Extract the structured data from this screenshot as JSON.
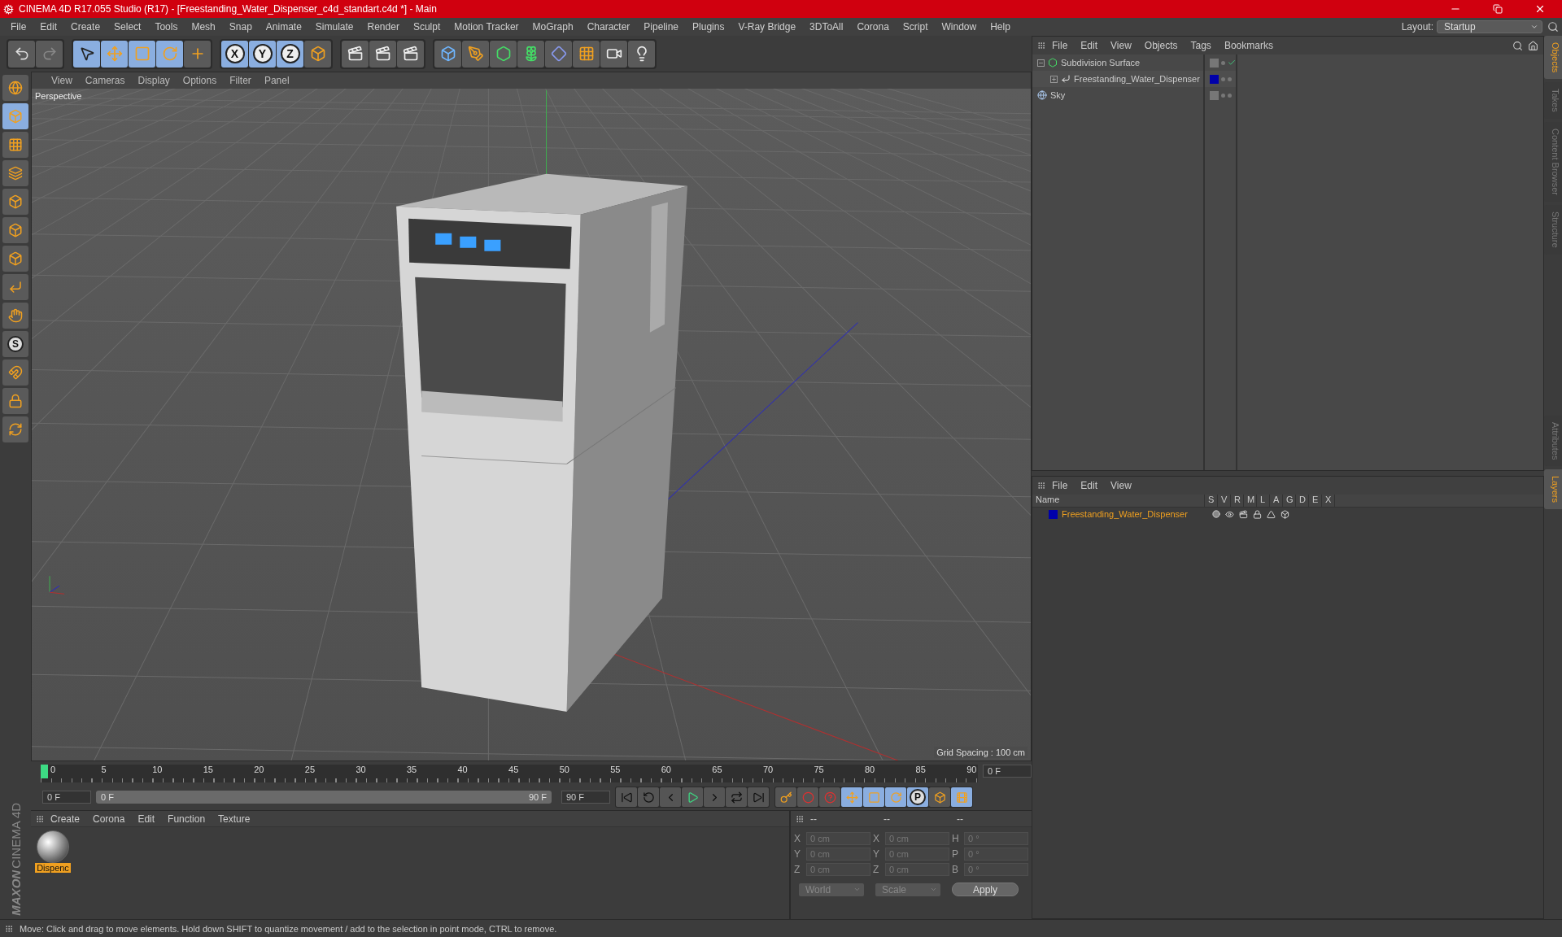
{
  "window": {
    "title": "CINEMA 4D R17.055 Studio (R17) - [Freestanding_Water_Dispenser_c4d_standart.c4d *] - Main"
  },
  "menu": [
    "File",
    "Edit",
    "Create",
    "Select",
    "Tools",
    "Mesh",
    "Snap",
    "Animate",
    "Simulate",
    "Render",
    "Sculpt",
    "Motion Tracker",
    "MoGraph",
    "Character",
    "Pipeline",
    "Plugins",
    "V-Ray Bridge",
    "3DToAll",
    "Corona",
    "Script",
    "Window",
    "Help"
  ],
  "layout": {
    "label": "Layout:",
    "value": "Startup"
  },
  "toolbar": [
    {
      "kind": "undo",
      "selected": false
    },
    {
      "kind": "redo",
      "selected": false
    },
    {
      "kind": "select",
      "selected": true
    },
    {
      "kind": "move",
      "selected": true
    },
    {
      "kind": "scale",
      "selected": true
    },
    {
      "kind": "rotate",
      "selected": true
    },
    {
      "kind": "transform",
      "selected": false
    },
    {
      "kind": "axis",
      "label": "X",
      "selected": true
    },
    {
      "kind": "axis",
      "label": "Y",
      "selected": true
    },
    {
      "kind": "axis",
      "label": "Z",
      "selected": true
    },
    {
      "kind": "coords",
      "selected": false
    },
    {
      "kind": "render-view",
      "selected": false
    },
    {
      "kind": "render-picture",
      "selected": false
    },
    {
      "kind": "render-settings",
      "selected": false
    },
    {
      "kind": "cube",
      "selected": false
    },
    {
      "kind": "pen",
      "selected": false
    },
    {
      "kind": "subdivide",
      "selected": false
    },
    {
      "kind": "cloner",
      "selected": false
    },
    {
      "kind": "deformer",
      "selected": false
    },
    {
      "kind": "floor",
      "selected": false
    },
    {
      "kind": "camera",
      "selected": false
    },
    {
      "kind": "light",
      "selected": false
    }
  ],
  "left_tools": [
    {
      "kind": "make-editable",
      "selected": false
    },
    {
      "kind": "model",
      "selected": true
    },
    {
      "kind": "texture",
      "selected": false
    },
    {
      "kind": "workplane",
      "selected": false
    },
    {
      "kind": "points",
      "selected": false
    },
    {
      "kind": "edges",
      "selected": false
    },
    {
      "kind": "polygons",
      "selected": false
    },
    {
      "kind": "axis",
      "selected": false
    },
    {
      "kind": "tweak",
      "selected": false
    },
    {
      "kind": "snap",
      "label": "S",
      "selected": false
    },
    {
      "kind": "magnet",
      "selected": false
    },
    {
      "kind": "grid-lock",
      "selected": false
    },
    {
      "kind": "grid-rotate",
      "selected": false
    }
  ],
  "viewport": {
    "menu": [
      "View",
      "Cameras",
      "Display",
      "Options",
      "Filter",
      "Panel"
    ],
    "label": "Perspective",
    "grid_spacing": "Grid Spacing : 100 cm"
  },
  "timeline": {
    "ticks": [
      "0",
      "5",
      "10",
      "15",
      "20",
      "25",
      "30",
      "35",
      "40",
      "45",
      "50",
      "55",
      "60",
      "65",
      "70",
      "75",
      "80",
      "85",
      "90"
    ],
    "current": "0 F",
    "start": "0 F",
    "range": {
      "start": "0 F",
      "end": "90 F",
      "level": 1
    },
    "end": "90 F",
    "transport": [
      {
        "kind": "first"
      },
      {
        "kind": "loop-back"
      },
      {
        "kind": "prev"
      },
      {
        "kind": "play"
      },
      {
        "kind": "next"
      },
      {
        "kind": "loop"
      },
      {
        "kind": "last"
      }
    ],
    "keys": [
      {
        "kind": "keyframe",
        "selected": false
      },
      {
        "kind": "record",
        "selected": false
      },
      {
        "kind": "auto-key",
        "selected": false
      },
      {
        "kind": "move",
        "selected": true
      },
      {
        "kind": "scale",
        "selected": true
      },
      {
        "kind": "rotate",
        "selected": true
      },
      {
        "kind": "param",
        "label": "P",
        "selected": true
      },
      {
        "kind": "points",
        "selected": false
      },
      {
        "kind": "film",
        "selected": true
      }
    ]
  },
  "materials": {
    "menu": [
      "Create",
      "Corona",
      "Edit",
      "Function",
      "Texture"
    ],
    "items": [
      {
        "name": "Dispenc",
        "selected": true
      }
    ]
  },
  "brand": {
    "top": "MAXON",
    "bottom": "CINEMA 4D"
  },
  "coordinates": {
    "headers": [
      "--",
      "--",
      "--"
    ],
    "rows": [
      [
        "X",
        "0 cm",
        "X",
        "0 cm",
        "H",
        "0 °"
      ],
      [
        "Y",
        "0 cm",
        "Y",
        "0 cm",
        "P",
        "0 °"
      ],
      [
        "Z",
        "0 cm",
        "Z",
        "0 cm",
        "B",
        "0 °"
      ]
    ],
    "space": "World",
    "mode": "Scale",
    "apply": "Apply"
  },
  "objects": {
    "menu": [
      "File",
      "Edit",
      "View",
      "Objects",
      "Tags",
      "Bookmarks"
    ],
    "items": [
      {
        "name": "Subdivision Surface",
        "kind": "subdivision",
        "expanded": true,
        "checked": true,
        "children": [
          {
            "name": "Freestanding_Water_Dispenser",
            "kind": "null",
            "expanded": false,
            "checked": false,
            "color": "#0000aa"
          }
        ]
      },
      {
        "name": "Sky",
        "kind": "sky",
        "checked": false
      }
    ]
  },
  "layers": {
    "menu": [
      "File",
      "Edit",
      "View"
    ],
    "columns": [
      "Name",
      "S",
      "V",
      "R",
      "M",
      "L",
      "A",
      "G",
      "D",
      "E",
      "X"
    ],
    "rows": [
      {
        "name": "Freestanding_Water_Dispenser",
        "color": "#0000aa"
      }
    ]
  },
  "side_tabs": {
    "top": [
      {
        "label": "Objects",
        "selected": true
      },
      {
        "label": "Takes",
        "selected": false
      },
      {
        "label": "Content Browser",
        "selected": false
      },
      {
        "label": "Structure",
        "selected": false
      }
    ],
    "bottom": [
      {
        "label": "Attributes",
        "selected": false
      },
      {
        "label": "Layers",
        "selected": true
      }
    ]
  },
  "status": "Move: Click and drag to move elements. Hold down SHIFT to quantize movement / add to the selection in point mode, CTRL to remove."
}
